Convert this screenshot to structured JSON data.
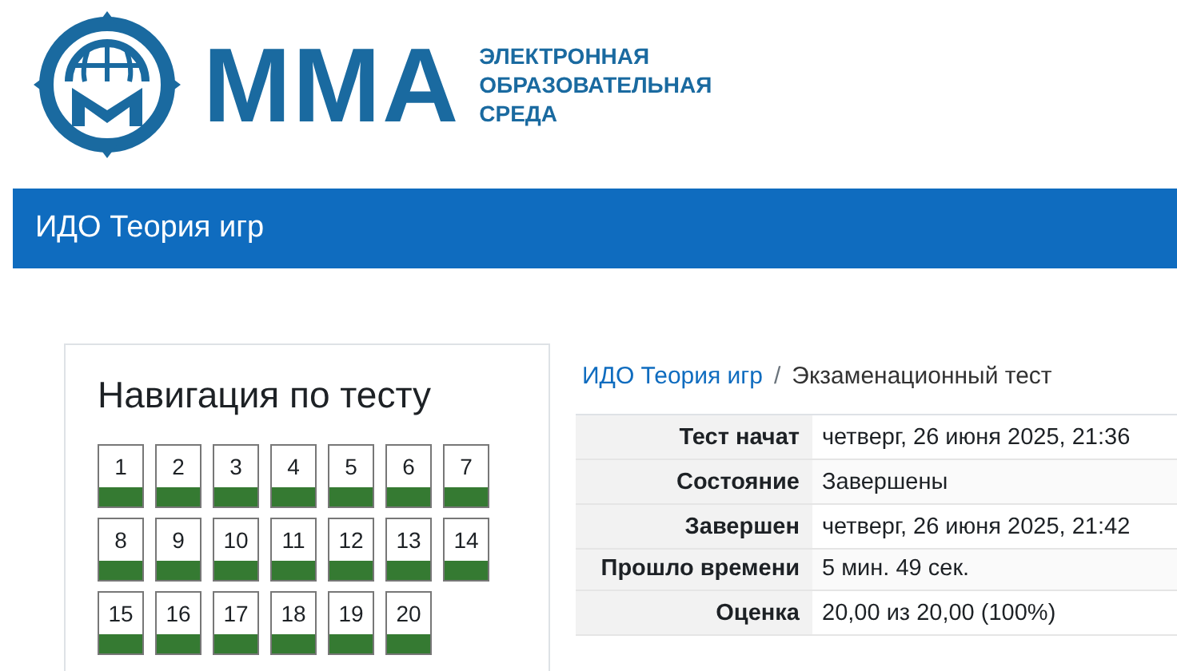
{
  "logo": {
    "wordmark": "ММА",
    "tagline": [
      "ЭЛЕКТРОННАЯ",
      "ОБРАЗОВАТЕЛЬНАЯ",
      "СРЕДА"
    ]
  },
  "header": {
    "title": "ИДО Теория игр"
  },
  "navigation": {
    "title": "Навигация по тесту",
    "questions": [
      {
        "label": "1",
        "correct": true
      },
      {
        "label": "2",
        "correct": true
      },
      {
        "label": "3",
        "correct": true
      },
      {
        "label": "4",
        "correct": true
      },
      {
        "label": "5",
        "correct": true
      },
      {
        "label": "6",
        "correct": true
      },
      {
        "label": "7",
        "correct": true
      },
      {
        "label": "8",
        "correct": true
      },
      {
        "label": "9",
        "correct": true
      },
      {
        "label": "10",
        "correct": true
      },
      {
        "label": "11",
        "correct": true
      },
      {
        "label": "12",
        "correct": true
      },
      {
        "label": "13",
        "correct": true
      },
      {
        "label": "14",
        "correct": true
      },
      {
        "label": "15",
        "correct": true
      },
      {
        "label": "16",
        "correct": true
      },
      {
        "label": "17",
        "correct": true
      },
      {
        "label": "18",
        "correct": true
      },
      {
        "label": "19",
        "correct": true
      },
      {
        "label": "20",
        "correct": true
      }
    ]
  },
  "breadcrumb": {
    "items": [
      "ИДО Теория игр",
      "Экзаменационный тест"
    ],
    "separator": "/"
  },
  "summary": {
    "rows": [
      {
        "label": "Тест начат",
        "value": "четверг, 26 июня 2025, 21:36"
      },
      {
        "label": "Состояние",
        "value": "Завершены"
      },
      {
        "label": "Завершен",
        "value": "четверг, 26 июня 2025, 21:42"
      },
      {
        "label": "Прошло времени",
        "value": "5 мин. 49 сек."
      },
      {
        "label": "Оценка",
        "value": "20,00 из 20,00 (100%)"
      }
    ]
  }
}
